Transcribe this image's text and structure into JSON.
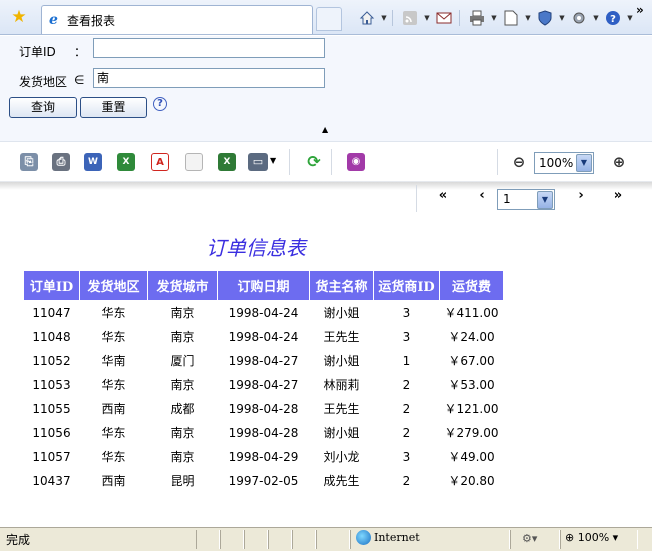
{
  "browser": {
    "tab_title": "查看报表",
    "chevron": "»",
    "command_icons": [
      "home-icon",
      "feeds-icon",
      "read-mail-icon",
      "print-icon",
      "page-icon",
      "safety-icon",
      "tools-icon",
      "help-icon"
    ]
  },
  "query": {
    "order_id_label": "订单ID",
    "order_id_colon": "：",
    "order_id_value": "",
    "region_label": "发货地区",
    "region_op": "∈",
    "region_value": "南",
    "search_button": "查询",
    "reset_button": "重置",
    "help": "?",
    "collapse": "▲"
  },
  "toolbar": {
    "icons": [
      "export-icon",
      "print-icon",
      "word-icon",
      "excel-icon",
      "pdf-icon",
      "text-icon",
      "excel-export-icon",
      "display-icon",
      "refresh-icon",
      "rss-icon",
      "zoom-out-icon",
      "zoom-in-icon"
    ],
    "zoom_value": "100%"
  },
  "pager": {
    "first": "«",
    "prev": "‹",
    "page_value": "1",
    "next": "›",
    "last": "»"
  },
  "report": {
    "title": "订单信息表",
    "columns": [
      "订单ID",
      "发货地区",
      "发货城市",
      "订购日期",
      "货主名称",
      "运货商ID",
      "运货费"
    ],
    "rows": [
      [
        "11047",
        "华东",
        "南京",
        "1998-04-24",
        "谢小姐",
        "3",
        "￥411.00"
      ],
      [
        "11048",
        "华东",
        "南京",
        "1998-04-24",
        "王先生",
        "3",
        "￥24.00"
      ],
      [
        "11052",
        "华南",
        "厦门",
        "1998-04-27",
        "谢小姐",
        "1",
        "￥67.00"
      ],
      [
        "11053",
        "华东",
        "南京",
        "1998-04-27",
        "林丽莉",
        "2",
        "￥53.00"
      ],
      [
        "11055",
        "西南",
        "成都",
        "1998-04-28",
        "王先生",
        "2",
        "￥121.00"
      ],
      [
        "11056",
        "华东",
        "南京",
        "1998-04-28",
        "谢小姐",
        "2",
        "￥279.00"
      ],
      [
        "11057",
        "华东",
        "南京",
        "1998-04-29",
        "刘小龙",
        "3",
        "￥49.00"
      ],
      [
        "10437",
        "西南",
        "昆明",
        "1997-02-05",
        "成先生",
        "2",
        "￥20.80"
      ]
    ]
  },
  "status": {
    "text": "完成",
    "zone": "Internet",
    "zoom": "100%"
  }
}
